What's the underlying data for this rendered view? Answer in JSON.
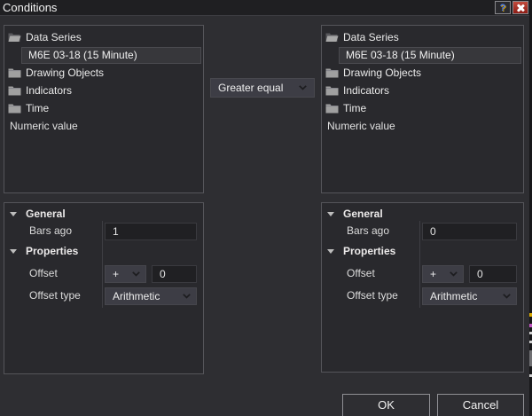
{
  "window": {
    "title": "Conditions",
    "help_glyph": "?"
  },
  "operator": {
    "value": "Greater equal"
  },
  "left": {
    "tree": [
      {
        "label": "Data Series"
      },
      {
        "label": "M6E 03-18 (15 Minute)"
      },
      {
        "label": "Drawing Objects"
      },
      {
        "label": "Indicators"
      },
      {
        "label": "Time"
      },
      {
        "label": "Numeric value"
      }
    ],
    "props": {
      "general_header": "General",
      "bars_ago_label": "Bars ago",
      "bars_ago_value": "1",
      "properties_header": "Properties",
      "offset_label": "Offset",
      "offset_operator": "+",
      "offset_value": "0",
      "offset_type_label": "Offset type",
      "offset_type_value": "Arithmetic"
    }
  },
  "right": {
    "tree": [
      {
        "label": "Data Series"
      },
      {
        "label": "M6E 03-18 (15 Minute)"
      },
      {
        "label": "Drawing Objects"
      },
      {
        "label": "Indicators"
      },
      {
        "label": "Time"
      },
      {
        "label": "Numeric value"
      }
    ],
    "props": {
      "general_header": "General",
      "bars_ago_label": "Bars ago",
      "bars_ago_value": "0",
      "properties_header": "Properties",
      "offset_label": "Offset",
      "offset_operator": "+",
      "offset_value": "0",
      "offset_type_label": "Offset type",
      "offset_type_value": "Arithmetic"
    }
  },
  "footer": {
    "ok_label": "OK",
    "cancel_label": "Cancel"
  },
  "colors": {
    "dialog_bg": "#2e2e32",
    "panel_bg": "#29292d",
    "panel_border": "#55555a",
    "control_bg": "#3d3d45",
    "input_bg": "#202023",
    "selection_bg": "#37373b",
    "close_red": "#a5231c",
    "help_accent": "#d9a40a"
  }
}
